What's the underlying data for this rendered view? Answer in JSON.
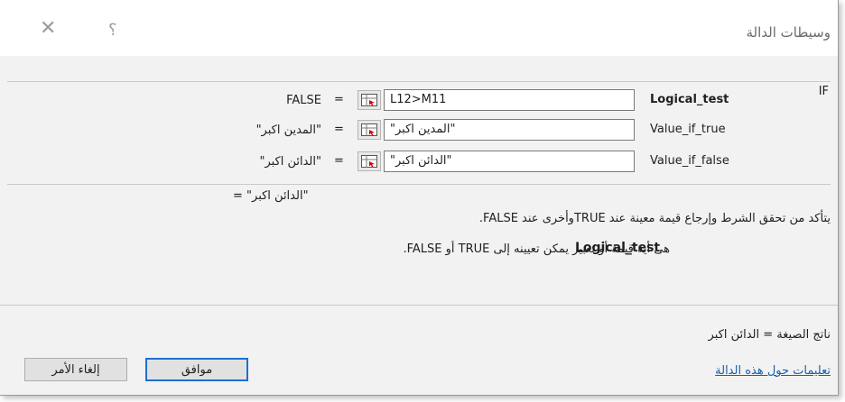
{
  "dialog": {
    "title": "وسيطات الدالة",
    "close_glyph": "✕",
    "help_glyph": "؟",
    "function_name": "IF"
  },
  "args": [
    {
      "label": "Logical_test",
      "bold": true,
      "value": "L12>M11",
      "result": "FALSE"
    },
    {
      "label": "Value_if_true",
      "bold": false,
      "value": "\"المدين اكبر\"",
      "result": "\"المدين اكبر\""
    },
    {
      "label": "Value_if_false",
      "bold": false,
      "value": "\"الدائن اكبر\"",
      "result": "\"الدائن اكبر\""
    }
  ],
  "equals_sign": "=",
  "formula_result_preview": "=  \"الدائن اكبر\"",
  "description": "يتأكد من تحقق الشرط وإرجاع قيمة معينة عند TRUEوأخرى عند FALSE.",
  "arg_help": {
    "label": "Logical_test",
    "text": "هى أية قيمة أو تعبير يمكن تعيينه إلى TRUE أو FALSE."
  },
  "result_line": "ناتج الصيغة =   الدائن اكبر",
  "help_link": "تعليمات حول هذه الدالة",
  "buttons": {
    "ok": "موافق",
    "cancel": "إلغاء الأمر"
  },
  "colors": {
    "panel": "#f2f2f2",
    "link": "#1a5fb4",
    "ok_border": "#1e6fd0"
  }
}
